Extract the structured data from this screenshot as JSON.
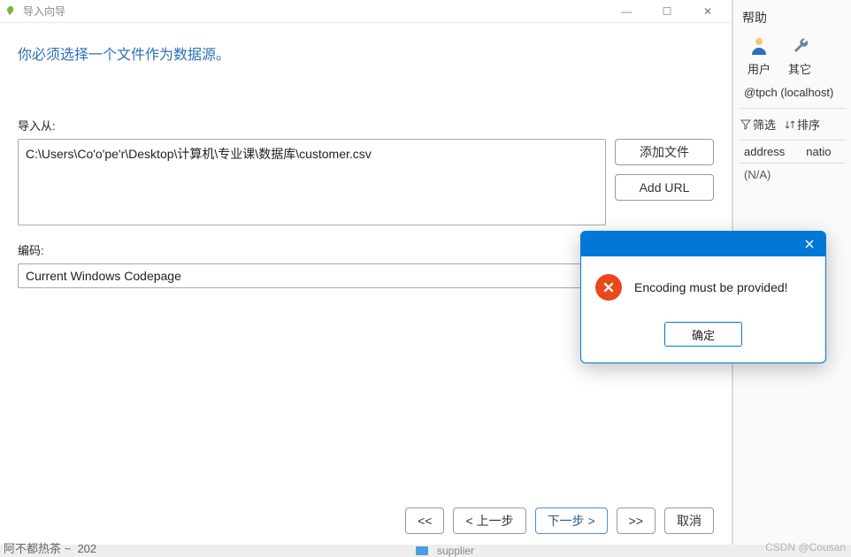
{
  "window": {
    "title": "导入向导",
    "minimize": "—",
    "maximize": "☐",
    "close": "✕"
  },
  "wizard": {
    "instruction": "你必须选择一个文件作为数据源。",
    "import_from_label": "导入从:",
    "file_path": "C:\\Users\\Co'o'pe'r\\Desktop\\计算机\\专业课\\数据库\\customer.csv",
    "add_file_label": "添加文件",
    "add_url_label": "Add URL",
    "encoding_label": "编码:",
    "encoding_value": "Current Windows Codepage"
  },
  "nav": {
    "first": "<<",
    "prev": "< 上一步",
    "next": "下一步 >",
    "last": ">>",
    "cancel": "取消"
  },
  "error_dialog": {
    "message": "Encoding must be provided!",
    "ok": "确定"
  },
  "backdrop": {
    "help": "帮助",
    "user": "用户",
    "other": "其它",
    "host": "@tpch (localhost)",
    "filter": "筛选",
    "sort": "排序",
    "col_address": "address",
    "col_nation": "natio",
    "na": "(N/A)"
  },
  "footer": {
    "supplier": "supplier",
    "truncated": "阿不都热茶 ~",
    "count": "202",
    "watermark": "CSDN @Cousan"
  }
}
